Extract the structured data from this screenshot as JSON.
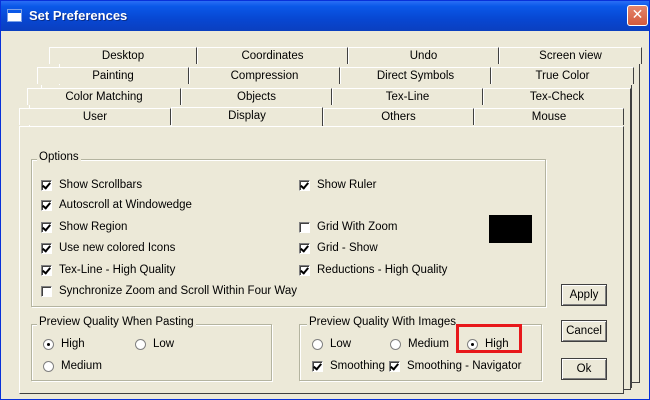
{
  "window": {
    "title": "Set Preferences",
    "close_label": "✕"
  },
  "tabs": {
    "row1": [
      "Desktop",
      "Coordinates",
      "Undo",
      "Screen view"
    ],
    "row2": [
      "Painting",
      "Compression",
      "Direct Symbols",
      "True Color"
    ],
    "row3": [
      "Color Matching",
      "Objects",
      "Tex-Line",
      "Tex-Check"
    ],
    "row4": [
      "User",
      "Display",
      "Others",
      "Mouse"
    ],
    "selected": "Display"
  },
  "options": {
    "label": "Options",
    "left": [
      {
        "label": "Show Scrollbars",
        "checked": true
      },
      {
        "label": "Autoscroll at Windowedge",
        "checked": true
      },
      {
        "label": "Show Region",
        "checked": true
      },
      {
        "label": "Use new colored Icons",
        "checked": true
      },
      {
        "label": "Tex-Line - High Quality",
        "checked": true
      },
      {
        "label": "Synchronize Zoom and Scroll Within Four Way",
        "checked": false
      }
    ],
    "right": [
      {
        "label": "Show Ruler",
        "checked": true
      },
      {
        "label": "Grid With Zoom",
        "checked": false
      },
      {
        "label": "Grid - Show",
        "checked": true
      },
      {
        "label": "Reductions - High Quality",
        "checked": true
      }
    ],
    "swatch_color": "#000000"
  },
  "paste_quality": {
    "label": "Preview Quality When Pasting",
    "high": "High",
    "low": "Low",
    "medium": "Medium",
    "selected": "High"
  },
  "image_quality": {
    "label": "Preview Quality With Images",
    "low": "Low",
    "medium": "Medium",
    "high": "High",
    "selected": "High",
    "smoothing": "Smoothing",
    "smoothing_navigator": "Smoothing - Navigator",
    "smoothing_checked": true,
    "smoothing_navigator_checked": true
  },
  "buttons": {
    "apply": "Apply",
    "cancel": "Cancel",
    "ok": "Ok"
  },
  "colors": {
    "titlebar": "#0a58e8",
    "highlight": "#e8181b",
    "face": "#ece9d8"
  }
}
